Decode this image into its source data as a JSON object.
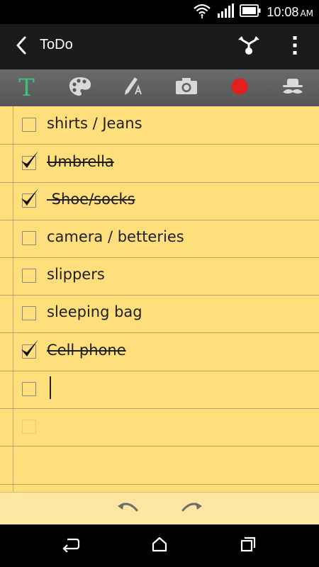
{
  "status": {
    "time": "10:08",
    "ampm": "AM"
  },
  "appbar": {
    "title": "ToDo"
  },
  "colors": {
    "paper": "#ffdf7c",
    "accent_t": "#3fbf7a",
    "record": "#e31e1e"
  },
  "toolbar": {
    "icons": [
      "text-icon",
      "palette-icon",
      "pen-icon",
      "camera-icon",
      "record-icon",
      "incognito-icon"
    ]
  },
  "checklist": [
    {
      "text": "shirts / Jeans",
      "checked": false
    },
    {
      "text": "Umbrella",
      "checked": true
    },
    {
      "text": " Shoe/socks",
      "checked": true
    },
    {
      "text": "camera / betteries",
      "checked": false
    },
    {
      "text": "slippers",
      "checked": false
    },
    {
      "text": "sleeping bag",
      "checked": false
    },
    {
      "text": "Cell phone",
      "checked": true
    },
    {
      "text": "",
      "checked": false
    }
  ]
}
